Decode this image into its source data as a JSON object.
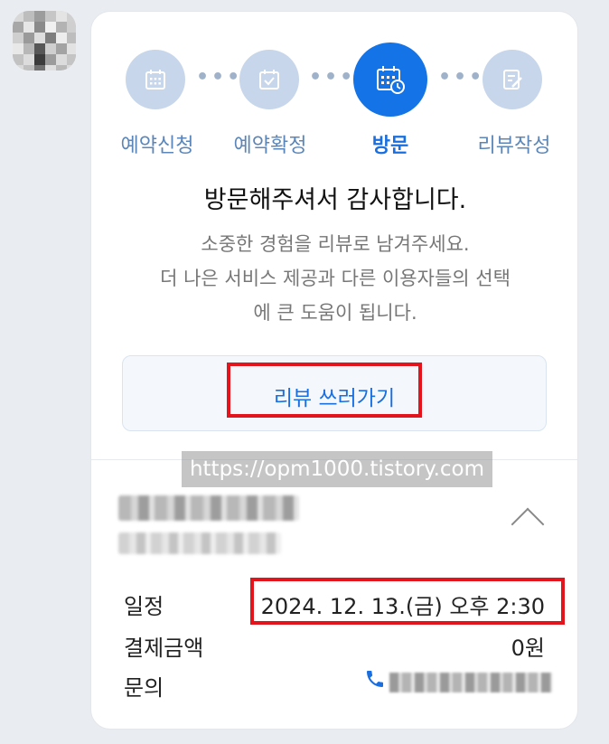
{
  "steps": [
    {
      "label": "예약신청",
      "icon": "calendar-icon",
      "active": false
    },
    {
      "label": "예약확정",
      "icon": "calendar-check-icon",
      "active": false
    },
    {
      "label": "방문",
      "icon": "calendar-clock-icon",
      "active": true
    },
    {
      "label": "리뷰작성",
      "icon": "edit-note-icon",
      "active": false
    }
  ],
  "visit": {
    "title": "방문해주셔서 감사합니다.",
    "desc_line1": "소중한 경험을 리뷰로 남겨주세요.",
    "desc_line2": "더 나은 서비스 제공과 다른 이용자들의 선택",
    "desc_line3": "에 큰 도움이 됩니다.",
    "review_button": "리뷰 쓰러가기"
  },
  "watermark": "https://opm1000.tistory.com",
  "details": {
    "schedule_label": "일정",
    "schedule_value": "2024. 12. 13.(금) 오후 2:30",
    "payment_label": "결제금액",
    "payment_value": "0원",
    "inquiry_label": "문의"
  },
  "colors": {
    "accent": "#1473e6",
    "step_inactive": "#c7d6ea",
    "highlight": "#e3141b"
  }
}
